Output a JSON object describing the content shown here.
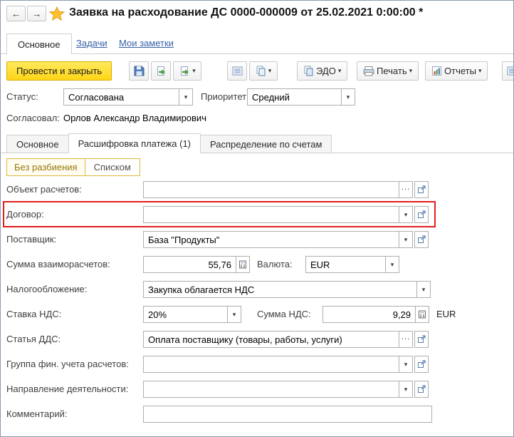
{
  "glyphs": {
    "back": "←",
    "forward": "→",
    "caret": "▾",
    "dots": "..."
  },
  "header": {
    "title": "Заявка на расходование ДС 0000-000009 от 25.02.2021 0:00:00 *"
  },
  "nav": {
    "main": "Основное",
    "tasks": "Задачи",
    "notes": "Мои заметки"
  },
  "toolbar": {
    "post_close": "Провести и закрыть",
    "edo": "ЭДО",
    "print": "Печать",
    "reports": "Отчеты"
  },
  "status": {
    "label": "Статус:",
    "value": "Согласована",
    "priority_label": "Приоритет:",
    "priority_value": "Средний",
    "approved_label": "Согласовал:",
    "approved_value": "Орлов Александр Владимирович"
  },
  "tabs": {
    "main": "Основное",
    "payment": "Расшифровка платежа (1)",
    "accounts": "Распределение по счетам"
  },
  "toggle": {
    "no_split": "Без разбиения",
    "as_list": "Списком"
  },
  "form": {
    "settlement_object_label": "Объект расчетов:",
    "settlement_object_value": "",
    "contract_label": "Договор:",
    "contract_value": "",
    "supplier_label": "Поставщик:",
    "supplier_value": "База \"Продукты\"",
    "amount_label": "Сумма взаиморасчетов:",
    "amount_value": "55,76",
    "currency_label": "Валюта:",
    "currency_value": "EUR",
    "tax_label": "Налогообложение:",
    "tax_value": "Закупка облагается НДС",
    "vat_rate_label": "Ставка НДС:",
    "vat_rate_value": "20%",
    "vat_amount_label": "Сумма НДС:",
    "vat_amount_value": "9,29",
    "vat_currency": "EUR",
    "dds_label": "Статья ДДС:",
    "dds_value": "Оплата поставщику (товары, работы, услуги)",
    "fin_group_label": "Группа фин. учета расчетов:",
    "fin_group_value": "",
    "activity_label": "Направление деятельности:",
    "activity_value": "",
    "comment_label": "Комментарий:",
    "comment_value": ""
  },
  "colors": {
    "accent_yellow": "#FFD517",
    "highlight_red": "#E0201C",
    "link_blue": "#3762A7"
  }
}
